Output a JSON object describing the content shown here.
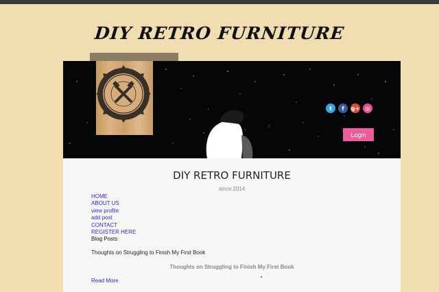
{
  "site": {
    "title": "DIY RETRO FURNITURE"
  },
  "banner": {
    "logo_alt": "DIY RETRO FURNITURE",
    "social": [
      {
        "name": "twitter",
        "glyph": "t",
        "color": "#3aa3e0"
      },
      {
        "name": "facebook",
        "glyph": "f",
        "color": "#3b5aa0"
      },
      {
        "name": "google-plus",
        "glyph": "g+",
        "color": "#e04b3b"
      },
      {
        "name": "dribbble",
        "glyph": "◎",
        "color": "#e8508c"
      }
    ],
    "login_label": "Login"
  },
  "main": {
    "title": "DIY RETRO FURNITURE",
    "since": "since 2014",
    "menu": [
      "HOME",
      "ABOUT US",
      "view profile",
      "add post",
      "CONTACT",
      "REGISTER HERE"
    ],
    "blog_posts_label": "Blog Posts",
    "post_text": "Thoughts on Struggling to Finish My First Book",
    "post_heading": "Thoughts on Struggling to Finish My First Book",
    "read_more": "Read More"
  }
}
